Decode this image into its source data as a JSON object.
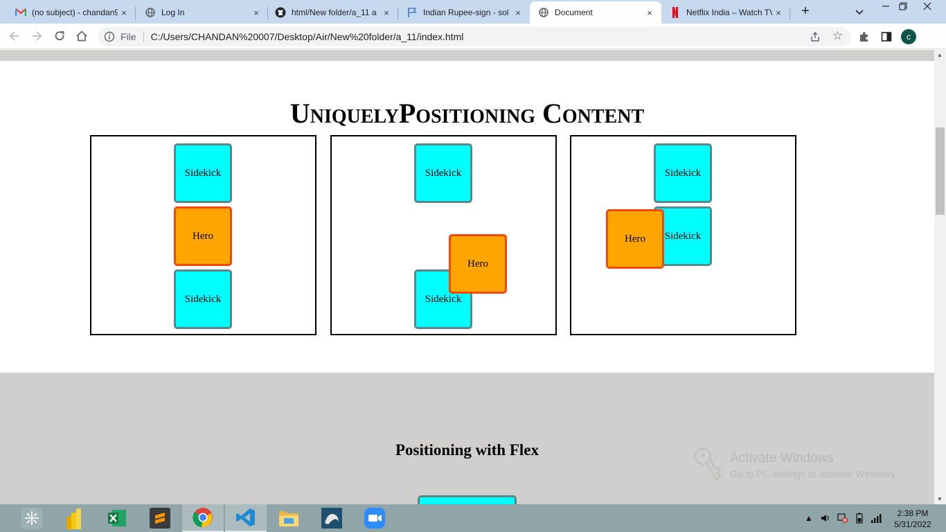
{
  "browser": {
    "tabs": [
      {
        "title": "(no subject) - chandan9",
        "icon": "gmail-icon",
        "active": false
      },
      {
        "title": "Log In",
        "icon": "globe-icon",
        "active": false
      },
      {
        "title": "html/New folder/a_11 a",
        "icon": "github-icon",
        "active": false
      },
      {
        "title": "Indian Rupee-sign - sol",
        "icon": "flag-icon",
        "active": false
      },
      {
        "title": "Document",
        "icon": "globe-icon",
        "active": true
      },
      {
        "title": "Netflix India – Watch TV",
        "icon": "netflix-icon",
        "active": false
      }
    ],
    "close_symbol": "×",
    "new_tab_symbol": "+",
    "omnibox": {
      "scheme_label": "File",
      "url": "C:/Users/CHANDAN%20007/Desktop/Air/New%20folder/a_11/index.html"
    },
    "profile_initial": "c"
  },
  "page": {
    "heading": "UniquelyPositioning Content",
    "box1": {
      "top": "Sidekick",
      "middle": "Hero",
      "bottom": "Sidekick"
    },
    "box2": {
      "top": "Sidekick",
      "bottom": "Sidekick",
      "hero": "Hero"
    },
    "box3": {
      "top": "Sidekick",
      "middle": "Sidekick",
      "hero": "Hero"
    },
    "flex_heading": "Positioning with Flex"
  },
  "watermark": {
    "line1": "Activate Windows",
    "line2": "Go to PC settings to activate Windows."
  },
  "taskbar": {
    "apps": [
      "tableau-icon",
      "powerbi-icon",
      "excel-icon",
      "sublime-icon",
      "chrome-icon",
      "vscode-icon",
      "file-explorer-icon",
      "mysql-icon",
      "zoom-icon"
    ],
    "active_app": "chrome-icon",
    "time": "2:38 PM",
    "date": "5/31/2022"
  },
  "colors": {
    "sidekick": "#00ffff",
    "hero": "#ffa500",
    "hero_border": "#f0480f",
    "sidekick_border": "#58878c",
    "tabstrip": "#c7d9ee",
    "section_gray": "#d0cfce"
  }
}
